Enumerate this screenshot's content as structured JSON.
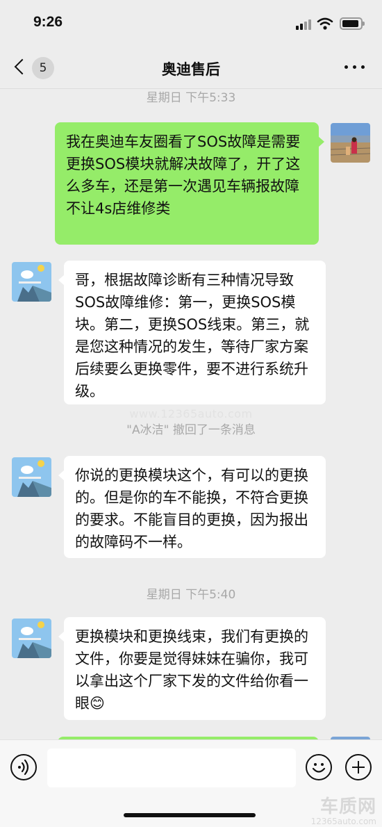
{
  "status_bar": {
    "time": "9:26"
  },
  "nav": {
    "back_badge": "5",
    "title": "奥迪售后"
  },
  "timestamps": [
    "星期日 下午5:33",
    "星期日 下午5:40"
  ],
  "messages": [
    {
      "side": "out",
      "text": "我在奥迪车友圈看了SOS故障是需要更换SOS模块就解决故障了，开了这么多车，还是第一次遇见车辆报故障不让4s店维修类"
    },
    {
      "side": "in",
      "text": "哥，根据故障诊断有三种情况导致SOS故障维修：第一，更换SOS模块。第二，更换SOS线束。第三，就是您这种情况的发生，等待厂家方案后续要么更换零件，要不进行系统升级。"
    },
    {
      "side": "in",
      "text": "你说的更换模块这个，有可以的更换的。但是你的车不能换，不符合更换的要求。不能盲目的更换，因为报出的故障码不一样。"
    },
    {
      "side": "in",
      "text": "更换模块和更换线束，我们有更换的文件，你要是觉得妹妹在骗你，我可以拿出这个厂家下发的文件给你看一眼😊"
    }
  ],
  "system_note": "\"A冰洁\" 撤回了一条消息",
  "watermark": {
    "url": "www.12365auto.com",
    "logo": "车质网",
    "logo_url": "12365auto.com"
  },
  "input": {
    "value": "",
    "placeholder": ""
  },
  "icons": {
    "signal": "signal-icon",
    "wifi": "wifi-icon",
    "battery": "battery-icon",
    "back": "chevron-left-icon",
    "more": "more-icon",
    "voice": "voice-icon",
    "emoji": "emoji-icon",
    "plus": "plus-icon"
  },
  "colors": {
    "outgoing_bubble": "#95ec69",
    "incoming_bubble": "#ffffff",
    "background": "#ededed"
  }
}
